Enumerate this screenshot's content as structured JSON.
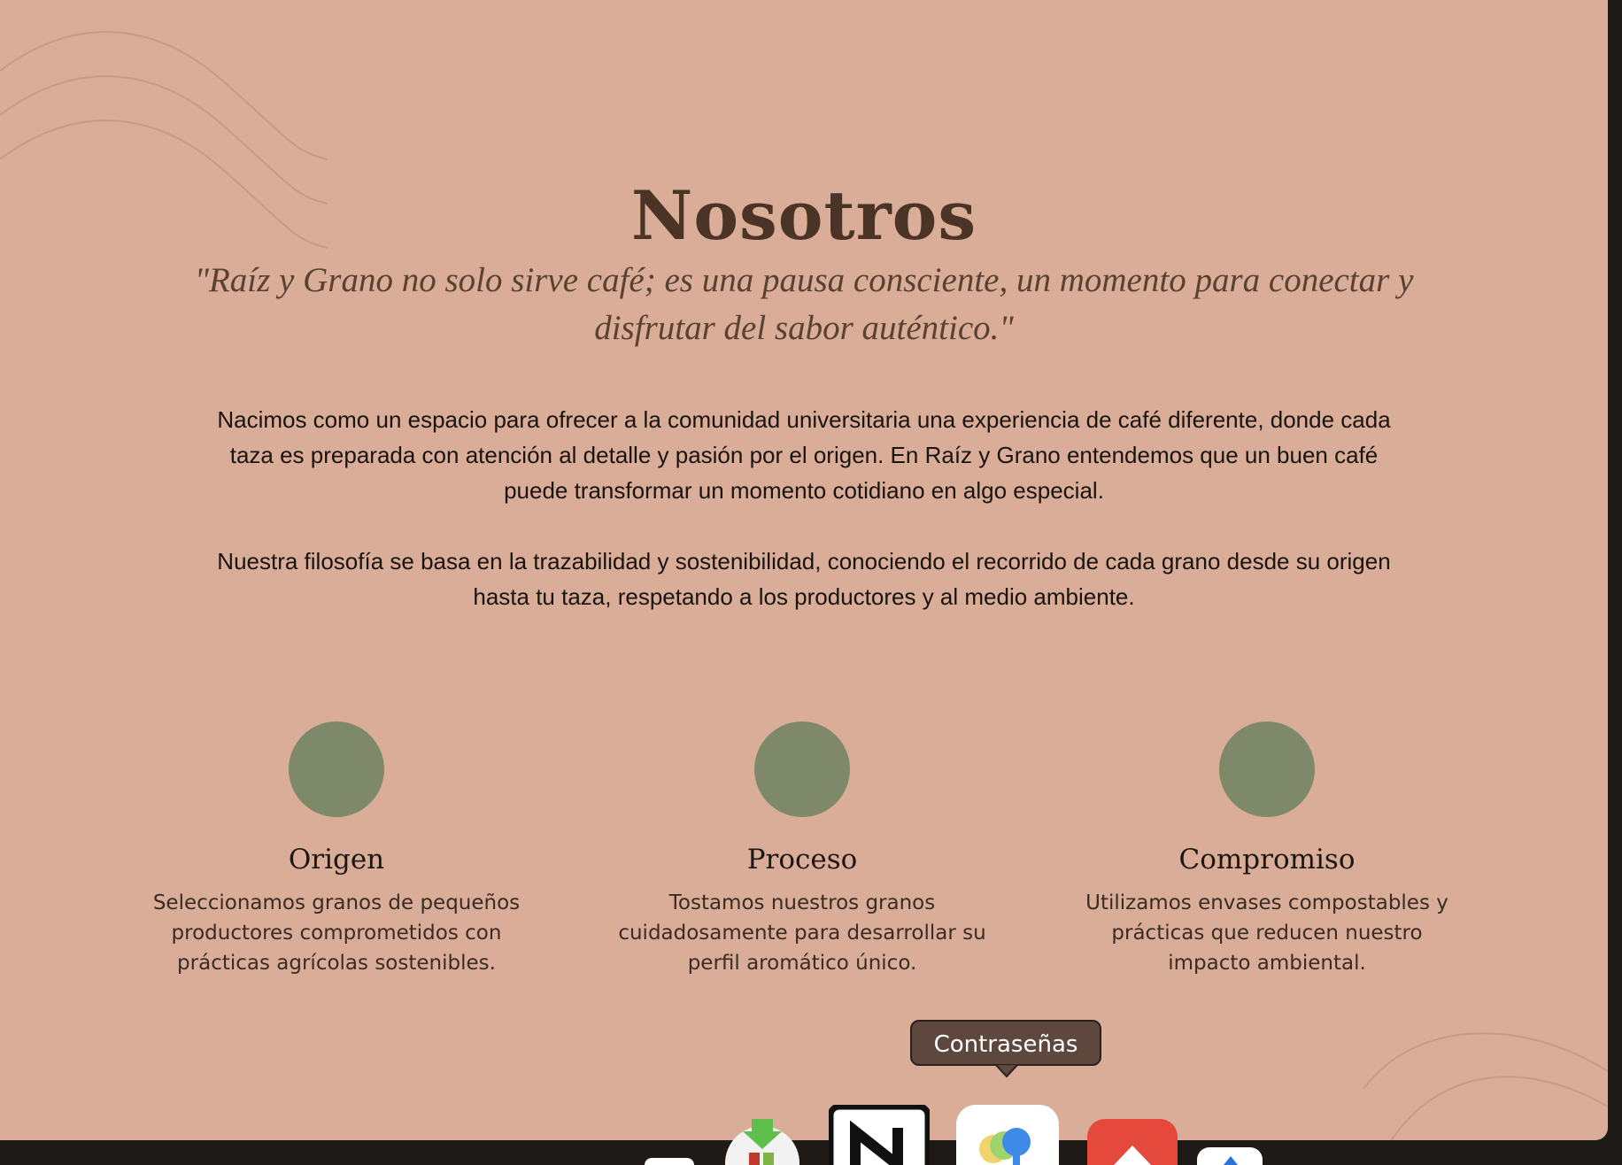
{
  "section": {
    "title": "Nosotros",
    "quote": "\"Raíz y Grano no solo sirve café; es una pausa consciente, un momento para conectar y disfrutar del sabor auténtico.\"",
    "paragraph_1": "Nacimos como un espacio para ofrecer a la comunidad universitaria una experiencia de café diferente, donde cada taza es preparada con atención al detalle y pasión por el origen. En Raíz y Grano entendemos que un buen café puede transformar un momento cotidiano en algo especial.",
    "paragraph_2": "Nuestra filosofía se basa en la trazabilidad y sostenibilidad, conociendo el recorrido de cada grano desde su origen hasta tu taza, respetando a los productores y al medio ambiente."
  },
  "features": [
    {
      "title": "Origen",
      "description": "Seleccionamos granos de pequeños productores comprometidos con prácticas agrícolas sostenibles."
    },
    {
      "title": "Proceso",
      "description": "Tostamos nuestros granos cuidadosamente para desarrollar su perfil aromático único."
    },
    {
      "title": "Compromiso",
      "description": "Utilizamos envases compostables y prácticas que reducen nuestro impacto ambiental."
    }
  ],
  "dock": {
    "tooltip": "Contraseñas",
    "icons": [
      "app-icon",
      "downloader-icon",
      "notion-icon",
      "passwords-icon",
      "app-icon",
      "app-icon"
    ]
  },
  "colors": {
    "background": "#d9ad98",
    "heading": "#4a3425",
    "circle": "#7e896a",
    "tooltip": "#5e473d"
  }
}
